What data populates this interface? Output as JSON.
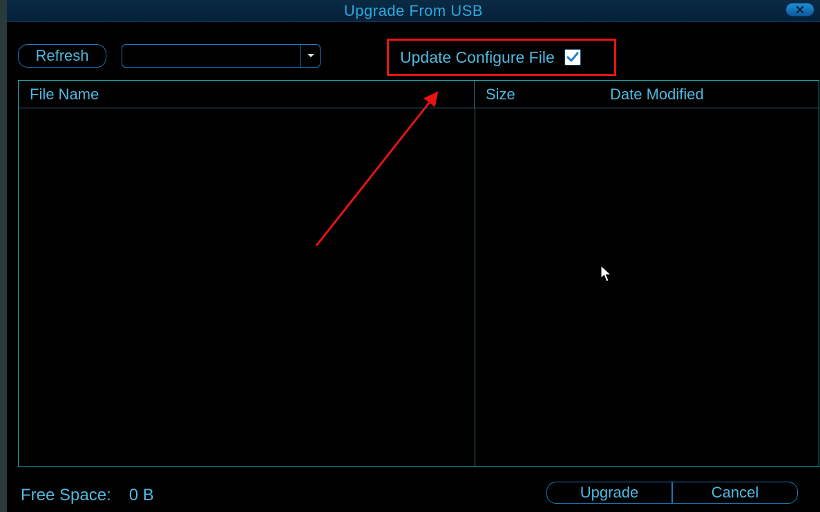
{
  "title": "Upgrade From USB",
  "toolbar": {
    "refresh_label": "Refresh",
    "dropdown_value": "",
    "update_configure_label": "Update Configure File",
    "update_configure_checked": true
  },
  "columns": {
    "file_name": "File Name",
    "size": "Size",
    "date_modified": "Date Modified"
  },
  "footer": {
    "free_space_label": "Free Space:",
    "free_space_value": "0 B",
    "upgrade_label": "Upgrade",
    "cancel_label": "Cancel"
  }
}
